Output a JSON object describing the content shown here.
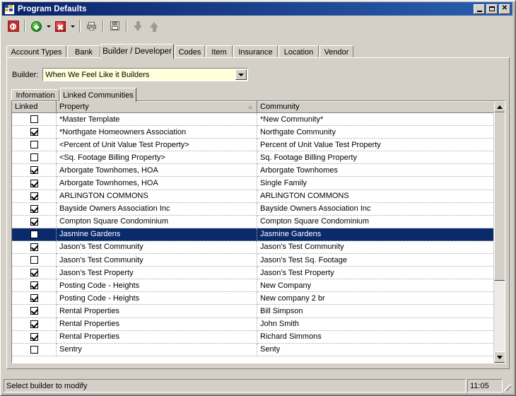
{
  "window": {
    "title": "Program Defaults",
    "icon": "program-defaults-icon",
    "minimize_label": "_",
    "maximize_label": "□",
    "close_label": "✕"
  },
  "toolbar": {
    "buttons": [
      {
        "name": "exit-button",
        "icon": "stop-icon",
        "has_dropdown": false
      },
      {
        "name": "add-button",
        "icon": "add-green-circle-icon",
        "has_dropdown": true
      },
      {
        "name": "delete-button",
        "icon": "delete-red-x-icon",
        "has_dropdown": true
      },
      {
        "name": "print-button",
        "icon": "printer-icon",
        "has_dropdown": false
      },
      {
        "name": "save-button",
        "icon": "save-disk-icon",
        "has_dropdown": false
      },
      {
        "name": "move-down-button",
        "icon": "arrow-down-icon",
        "has_dropdown": false
      },
      {
        "name": "move-up-button",
        "icon": "arrow-up-icon",
        "has_dropdown": false
      }
    ]
  },
  "tabs": [
    {
      "label": "Account Types",
      "active": false
    },
    {
      "label": "Bank",
      "active": false
    },
    {
      "label": "Builder / Developer",
      "active": true
    },
    {
      "label": "Codes",
      "active": false
    },
    {
      "label": "Item",
      "active": false
    },
    {
      "label": "Insurance",
      "active": false
    },
    {
      "label": "Location",
      "active": false
    },
    {
      "label": "Vendor",
      "active": false
    }
  ],
  "builder": {
    "label": "Builder:",
    "value": "When We Feel Like it Builders",
    "dropdown_icon": "chevron-down-icon"
  },
  "inner_tabs": [
    {
      "label": "Information",
      "active": false
    },
    {
      "label": "Linked Communities",
      "active": true
    }
  ],
  "grid": {
    "columns": [
      {
        "label": "Linked",
        "sorted": false
      },
      {
        "label": "Property",
        "sorted": true
      },
      {
        "label": "Community",
        "sorted": true
      }
    ],
    "rows": [
      {
        "linked": false,
        "property": "*Master Template",
        "community": "*New Community*",
        "selected": false
      },
      {
        "linked": true,
        "property": "*Northgate Homeowners Association",
        "community": "Northgate Community",
        "selected": false
      },
      {
        "linked": false,
        "property": "<Percent of Unit Value Test Property>",
        "community": "Percent of Unit Value Test Property",
        "selected": false
      },
      {
        "linked": false,
        "property": "<Sq. Footage Billing Property>",
        "community": "Sq. Footage Billing Property",
        "selected": false
      },
      {
        "linked": true,
        "property": "Arborgate Townhomes, HOA",
        "community": "Arborgate Townhomes",
        "selected": false
      },
      {
        "linked": true,
        "property": "Arborgate Townhomes, HOA",
        "community": "Single Family",
        "selected": false
      },
      {
        "linked": true,
        "property": "ARLINGTON COMMONS",
        "community": "ARLINGTON COMMONS",
        "selected": false
      },
      {
        "linked": true,
        "property": "Bayside Owners Association Inc",
        "community": "Bayside Owners Association Inc",
        "selected": false
      },
      {
        "linked": true,
        "property": "Compton  Square Condominium",
        "community": "Compton  Square Condominium",
        "selected": false
      },
      {
        "linked": false,
        "property": "Jasmine Gardens",
        "community": "Jasmine Gardens",
        "selected": true
      },
      {
        "linked": true,
        "property": "Jason's Test Community",
        "community": "Jason's Test Community",
        "selected": false
      },
      {
        "linked": false,
        "property": "Jason's Test Community",
        "community": "Jason's Test Sq. Footage",
        "selected": false
      },
      {
        "linked": true,
        "property": "Jason's Test Property",
        "community": "Jason's Test Property",
        "selected": false
      },
      {
        "linked": true,
        "property": "Posting Code - Heights",
        "community": "New Company",
        "selected": false
      },
      {
        "linked": true,
        "property": "Posting Code - Heights",
        "community": "New company 2 br",
        "selected": false
      },
      {
        "linked": true,
        "property": "Rental Properties",
        "community": "Bill Simpson",
        "selected": false
      },
      {
        "linked": true,
        "property": "Rental Properties",
        "community": "John Smith",
        "selected": false
      },
      {
        "linked": true,
        "property": "Rental Properties",
        "community": "Richard Simmons",
        "selected": false
      },
      {
        "linked": false,
        "property": "Sentry",
        "community": "Senty",
        "selected": false
      }
    ],
    "scrollbar": {
      "up_icon": "scroll-up-icon",
      "down_icon": "scroll-down-icon"
    }
  },
  "statusbar": {
    "message": "Select builder to modify",
    "time": "11:05"
  },
  "colors": {
    "titlebar_start": "#0a246a",
    "titlebar_end": "#2b5fb0",
    "face": "#d4d0c8",
    "selection": "#0a2a6b",
    "combo_field": "#ffffdc"
  }
}
